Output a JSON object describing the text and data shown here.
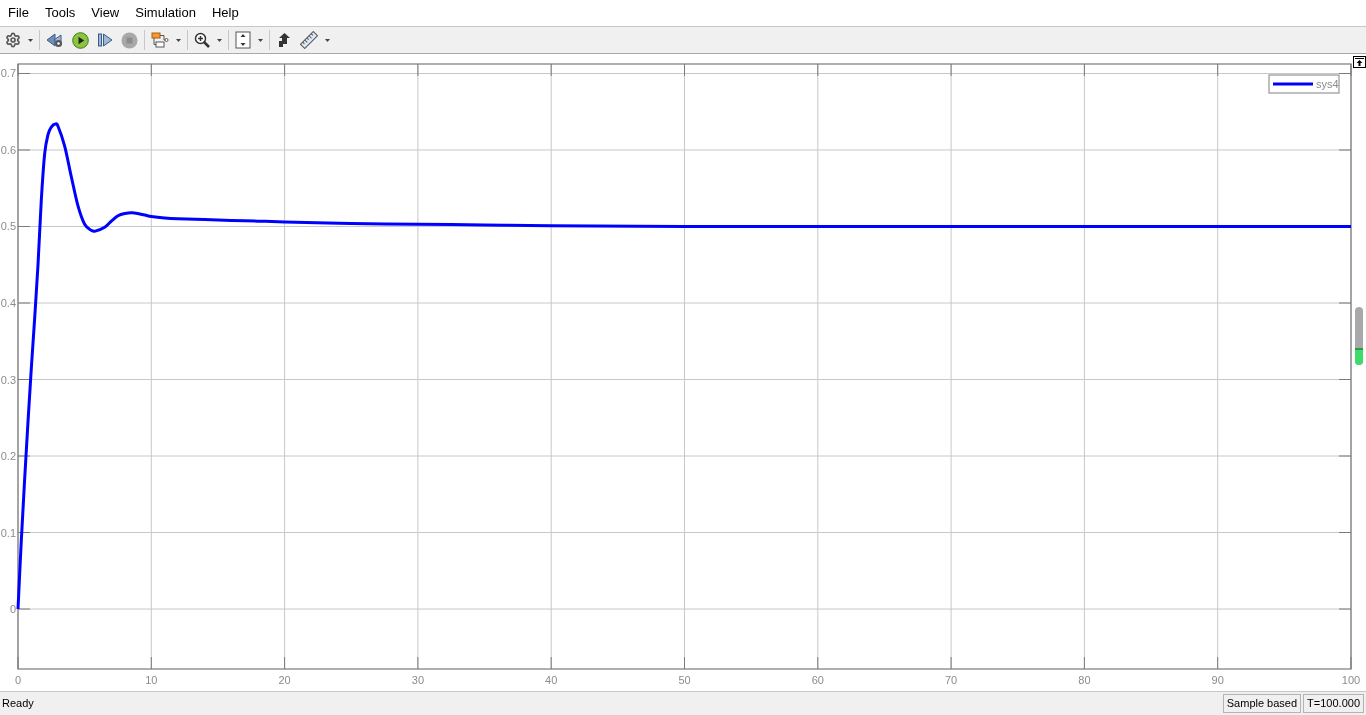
{
  "menu": [
    "File",
    "Tools",
    "View",
    "Simulation",
    "Help"
  ],
  "toolbar": {
    "groups": [
      {
        "buttons": [
          {
            "kind": "settings",
            "dropdown": true,
            "disabled": false
          }
        ]
      },
      {
        "buttons": [
          {
            "kind": "step_back",
            "dropdown": false,
            "disabled": false
          },
          {
            "kind": "run",
            "dropdown": false,
            "disabled": false
          },
          {
            "kind": "step_forward",
            "dropdown": false,
            "disabled": false
          },
          {
            "kind": "stop",
            "dropdown": false,
            "disabled": true
          }
        ]
      },
      {
        "buttons": [
          {
            "kind": "signal_select",
            "dropdown": true,
            "disabled": false
          }
        ]
      },
      {
        "buttons": [
          {
            "kind": "zoom",
            "dropdown": true,
            "disabled": false
          }
        ]
      },
      {
        "buttons": [
          {
            "kind": "autoscale",
            "dropdown": true,
            "disabled": false
          }
        ]
      },
      {
        "buttons": [
          {
            "kind": "highlight",
            "dropdown": false,
            "disabled": false
          },
          {
            "kind": "measure",
            "dropdown": true,
            "disabled": false
          }
        ]
      }
    ]
  },
  "scope": {
    "chart_data": [
      {
        "type": "line",
        "xlim": [
          0,
          100
        ],
        "ylim": [
          -0.0784,
          0.7124
        ],
        "xticks": [
          0,
          10,
          20,
          30,
          40,
          50,
          60,
          70,
          80,
          90,
          100
        ],
        "yticks": [
          0,
          0.1,
          0.2,
          0.3,
          0.4,
          0.5,
          0.6,
          0.7
        ],
        "grid": true,
        "legend": "top-right",
        "series": [
          {
            "name": "sys4",
            "color": "#0000ff",
            "x": [
              0,
              0.25,
              0.5,
              0.75,
              1,
              1.25,
              1.5,
              1.75,
              2,
              2.25,
              2.5,
              2.8,
              3,
              3.5,
              4,
              4.5,
              5,
              5.5,
              5.8,
              6.5,
              7,
              7.5,
              8,
              8.6,
              9.5,
              10,
              11,
              12,
              14,
              16,
              18,
              20,
              25,
              30,
              35,
              40,
              50,
              60,
              70,
              80,
              90,
              100
            ],
            "values": [
              0,
              0.09,
              0.17,
              0.245,
              0.315,
              0.38,
              0.45,
              0.535,
              0.595,
              0.62,
              0.63,
              0.634,
              0.631,
              0.605,
              0.565,
              0.527,
              0.503,
              0.495,
              0.494,
              0.499,
              0.507,
              0.514,
              0.517,
              0.518,
              0.515,
              0.513,
              0.511,
              0.51,
              0.509,
              0.508,
              0.507,
              0.506,
              0.504,
              0.503,
              0.502,
              0.501,
              0.5,
              0.5,
              0.5,
              0.5,
              0.5,
              0.5
            ]
          }
        ]
      }
    ]
  },
  "status_bar": {
    "message": "Ready",
    "sample_mode": "Sample based",
    "time": "T=100.000"
  }
}
